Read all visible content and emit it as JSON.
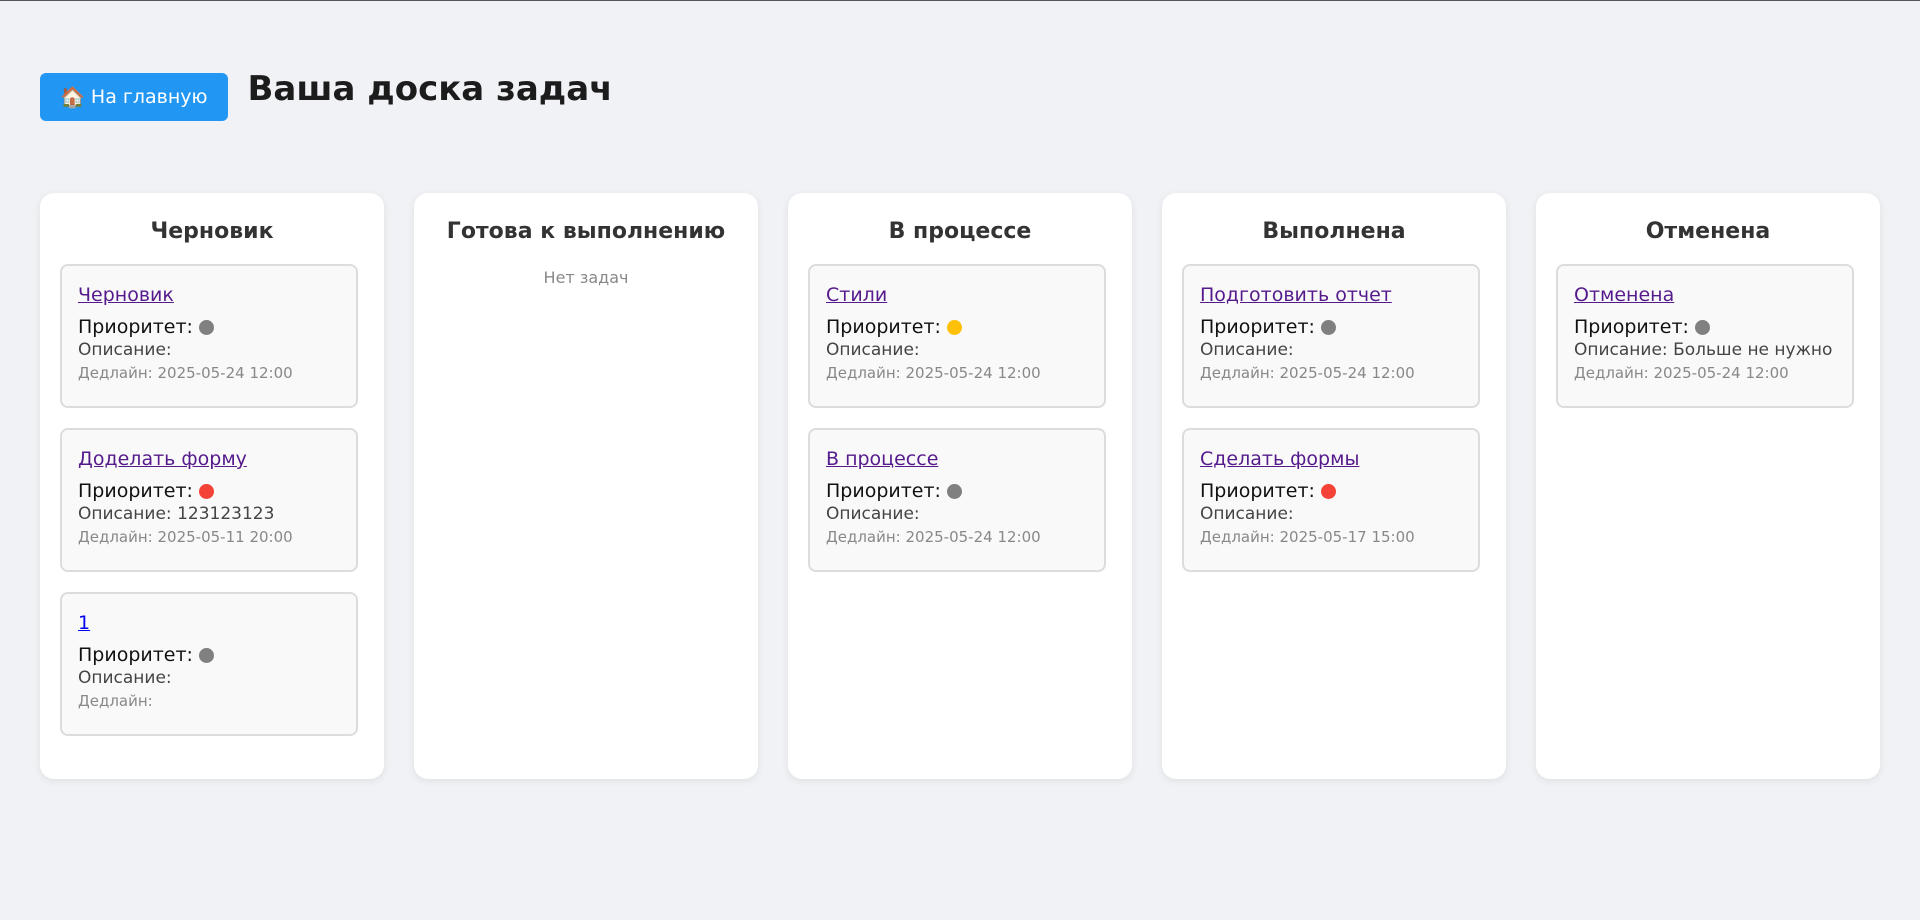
{
  "header": {
    "home_icon": "🏠",
    "home_label": "На главную",
    "title": "Ваша доска задач"
  },
  "labels": {
    "priority": "Приоритет:",
    "description": "Описание:",
    "deadline": "Дедлайн:",
    "empty": "Нет задач"
  },
  "colors": {
    "gray": "#808080",
    "red": "#f44336",
    "yellow": "#ffc107",
    "accent": "#2196f3"
  },
  "columns": [
    {
      "title": "Черновик",
      "tasks": [
        {
          "title": "Черновик",
          "priority": "gray",
          "description": "",
          "deadline": "2025-05-24 12:00"
        },
        {
          "title": "Доделать форму",
          "priority": "red",
          "description": "123123123",
          "deadline": "2025-05-11 20:00"
        },
        {
          "title": "1",
          "priority": "gray",
          "description": "",
          "deadline": "",
          "unvisited": true
        }
      ]
    },
    {
      "title": "Готова к выполнению",
      "tasks": []
    },
    {
      "title": "В процессе",
      "tasks": [
        {
          "title": "Стили",
          "priority": "yellow",
          "description": "",
          "deadline": "2025-05-24 12:00"
        },
        {
          "title": "В процессе",
          "priority": "gray",
          "description": "",
          "deadline": "2025-05-24 12:00"
        }
      ]
    },
    {
      "title": "Выполнена",
      "tasks": [
        {
          "title": "Подготовить отчет",
          "priority": "gray",
          "description": "",
          "deadline": "2025-05-24 12:00"
        },
        {
          "title": "Сделать формы",
          "priority": "red",
          "description": "",
          "deadline": "2025-05-17 15:00"
        }
      ]
    },
    {
      "title": "Отменена",
      "tasks": [
        {
          "title": "Отменена",
          "priority": "gray",
          "description": "Больше не нужно",
          "deadline": "2025-05-24 12:00"
        }
      ]
    }
  ]
}
